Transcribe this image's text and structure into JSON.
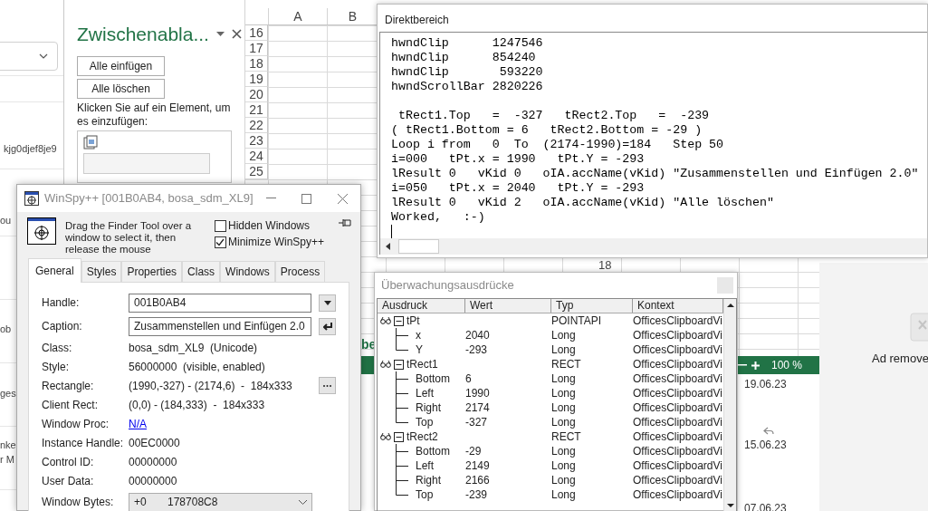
{
  "mail_list": {
    "fragments": [
      "kjg0djef8je9",
      "ou",
      "ob",
      "ges",
      "nke",
      "r M"
    ],
    "dates": [
      "19.06.23",
      "15.06.23",
      "07.06.23"
    ]
  },
  "clipboard_pane": {
    "title": "Zwischenabla...",
    "buttons": [
      "Alle einfügen",
      "Alle löschen"
    ],
    "hint": "Klicken Sie auf ein Element, um es einzufügen:"
  },
  "sheet": {
    "columns": [
      "A",
      "B"
    ],
    "rows": [
      "16",
      "17",
      "18",
      "19",
      "20",
      "21",
      "22",
      "23",
      "24",
      "25"
    ],
    "column_header_fragment": "18",
    "sheet_tab_fragment": "be",
    "zoom": "100 %"
  },
  "immediate_window": {
    "title": "Direktbereich",
    "blocks": [
      [
        "hwndClip      1247546",
        "hwndClip      854240",
        "hwndClip       593220",
        "hwndScrollBar 2820226"
      ],
      [
        " tRect1.Top   =  -327   tRect2.Top   =  -239",
        "( tRect1.Bottom = 6   tRect2.Bottom = -29 )",
        "Loop i from   0  To  (2174-1990)=184   Step 50",
        "i=000   tPt.x = 1990   tPt.Y = -293",
        "lResult 0   vKid 0   oIA.accName(vKid) \"Zusammenstellen und Einfügen 2.0\"",
        "i=050   tPt.x = 2040   tPt.Y = -293",
        "lResult 0   vKid 2   oIA.accName(vKid) \"Alle löschen\"",
        "Worked,   :-)"
      ]
    ]
  },
  "winspy": {
    "title": "WinSpy++ [001B0AB4, bosa_sdm_XL9]",
    "instruction": "Drag the Finder Tool over a window to select it, then release the mouse",
    "checkboxes": [
      {
        "label": "Hidden Windows",
        "checked": false
      },
      {
        "label": "Minimize WinSpy++",
        "checked": true
      }
    ],
    "tabs": [
      {
        "label": "General",
        "selected": true
      },
      {
        "label": "Styles",
        "selected": false
      },
      {
        "label": "Properties",
        "selected": false
      },
      {
        "label": "Class",
        "selected": false
      },
      {
        "label": "Windows",
        "selected": false
      },
      {
        "label": "Process",
        "selected": false
      }
    ],
    "fields": [
      {
        "label": "Handle:",
        "value": "001B0AB4",
        "kind": "dropdown-input"
      },
      {
        "label": "Caption:",
        "value": "Zusammenstellen und Einfügen 2.0",
        "kind": "enter-input"
      },
      {
        "label": "Class:",
        "value": "bosa_sdm_XL9  (Unicode)",
        "kind": "text"
      },
      {
        "label": "Style:",
        "value": "56000000  (visible, enabled)",
        "kind": "text"
      },
      {
        "label": "Rectangle:",
        "value": "(1990,-327) - (2174,6)  -  184x333",
        "kind": "more-text"
      },
      {
        "label": "Client Rect:",
        "value": "(0,0) - (184,333)  -  184x333",
        "kind": "text"
      },
      {
        "label": "Window Proc:",
        "value": "N/A",
        "kind": "link"
      },
      {
        "label": "Instance Handle:",
        "value": "00EC0000",
        "kind": "text"
      },
      {
        "label": "Control ID:",
        "value": "00000000",
        "kind": "text"
      },
      {
        "label": "User Data:",
        "value": "00000000",
        "kind": "text"
      },
      {
        "label": "Window Bytes:",
        "value": "+0       178708C8",
        "kind": "select"
      }
    ]
  },
  "watch_window": {
    "title": "Überwachungsausdrücke",
    "columns": [
      "Ausdruck",
      "Wert",
      "Typ",
      "Kontext"
    ],
    "items": [
      {
        "expression": "tPt",
        "type": "POINTAPI",
        "context": "OfficesClipboardVi",
        "expanded": true,
        "children": [
          {
            "expression": "x",
            "value": "2040",
            "type": "Long",
            "context": "OfficesClipboardVi"
          },
          {
            "expression": "Y",
            "value": "-293",
            "type": "Long",
            "context": "OfficesClipboardVi"
          }
        ]
      },
      {
        "expression": "tRect1",
        "type": "RECT",
        "context": "OfficesClipboardVi",
        "expanded": true,
        "children": [
          {
            "expression": "Bottom",
            "value": "6",
            "type": "Long",
            "context": "OfficesClipboardVi"
          },
          {
            "expression": "Left",
            "value": "1990",
            "type": "Long",
            "context": "OfficesClipboardVi"
          },
          {
            "expression": "Right",
            "value": "2174",
            "type": "Long",
            "context": "OfficesClipboardVi"
          },
          {
            "expression": "Top",
            "value": "-327",
            "type": "Long",
            "context": "OfficesClipboardVi"
          }
        ]
      },
      {
        "expression": "tRect2",
        "type": "RECT",
        "context": "OfficesClipboardVi",
        "expanded": true,
        "children": [
          {
            "expression": "Bottom",
            "value": "-29",
            "type": "Long",
            "context": "OfficesClipboardVi"
          },
          {
            "expression": "Left",
            "value": "2149",
            "type": "Long",
            "context": "OfficesClipboardVi"
          },
          {
            "expression": "Right",
            "value": "2166",
            "type": "Long",
            "context": "OfficesClipboardVi"
          },
          {
            "expression": "Top",
            "value": "-239",
            "type": "Long",
            "context": "OfficesClipboardVi"
          }
        ]
      }
    ]
  },
  "ad_panel": {
    "text": "Ad remove"
  }
}
